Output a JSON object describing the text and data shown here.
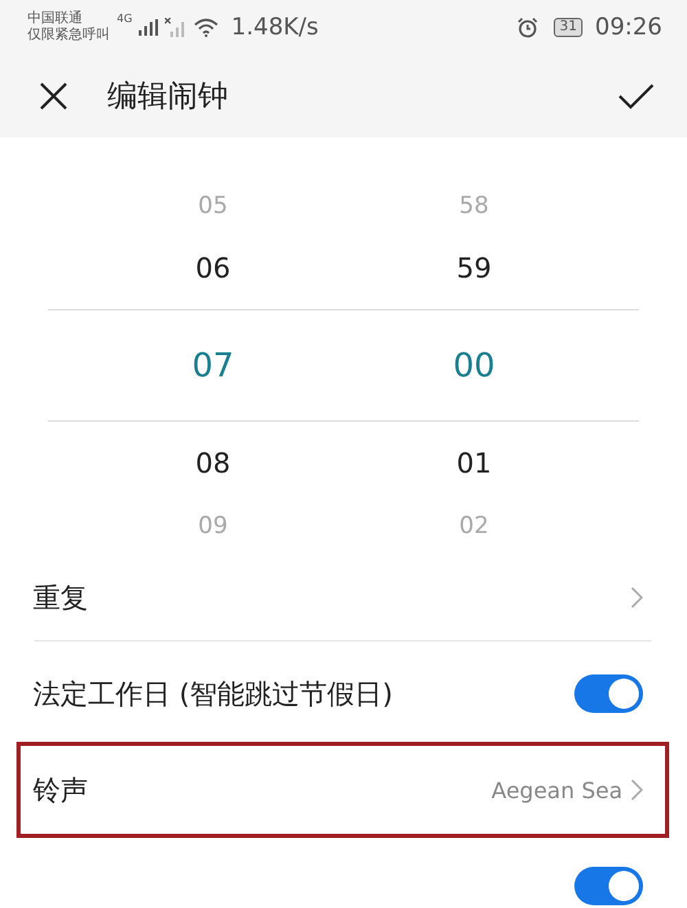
{
  "status_bar": {
    "carrier": [
      "中国联通",
      "仅限紧急呼叫"
    ],
    "network": "4G",
    "speed": "1.48K/s",
    "battery": "31",
    "time": "09:26"
  },
  "header": {
    "title": "编辑闹钟"
  },
  "picker": {
    "columns": [
      {
        "items": [
          {
            "value": "05",
            "selected": false
          },
          {
            "value": "06",
            "selected": false
          },
          {
            "value": "07",
            "selected": true
          },
          {
            "value": "08",
            "selected": false
          },
          {
            "value": "09",
            "selected": false
          }
        ]
      },
      {
        "items": [
          {
            "value": "58",
            "selected": false
          },
          {
            "value": "59",
            "selected": false
          },
          {
            "value": "00",
            "selected": true
          },
          {
            "value": "01",
            "selected": false
          },
          {
            "value": "02",
            "selected": false
          }
        ]
      }
    ]
  },
  "settings": [
    {
      "kind": "link",
      "label": "重复",
      "highlighted": false
    },
    {
      "kind": "toggle",
      "label": "法定工作日 (智能跳过节假日)",
      "on": true,
      "highlighted": false
    },
    {
      "kind": "link",
      "label": "铃声",
      "value": "Aegean Sea",
      "highlighted": true
    },
    {
      "kind": "toggle",
      "on": true,
      "highlighted": false
    }
  ]
}
